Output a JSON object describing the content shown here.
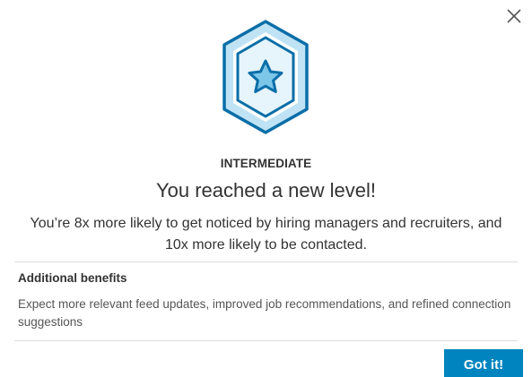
{
  "dialog": {
    "close_icon": "close-icon",
    "badge_icon": "star-hexagon-badge-icon",
    "level_name": "INTERMEDIATE",
    "headline": "You reached a new level!",
    "description": "You’re 8x more likely to get noticed by hiring managers and recruiters, and 10x more likely to be contacted.",
    "benefits_heading": "Additional benefits",
    "benefits_text": "Expect more relevant feed updates, improved job recommendations, and refined connection suggestions",
    "confirm_label": "Got it!"
  },
  "colors": {
    "accent": "#0084bf",
    "badge_outline": "#0a6ea8",
    "badge_fill": "#bfe3f4",
    "badge_inner": "#e6f4fb",
    "text": "#333333",
    "divider": "#dddddd"
  }
}
